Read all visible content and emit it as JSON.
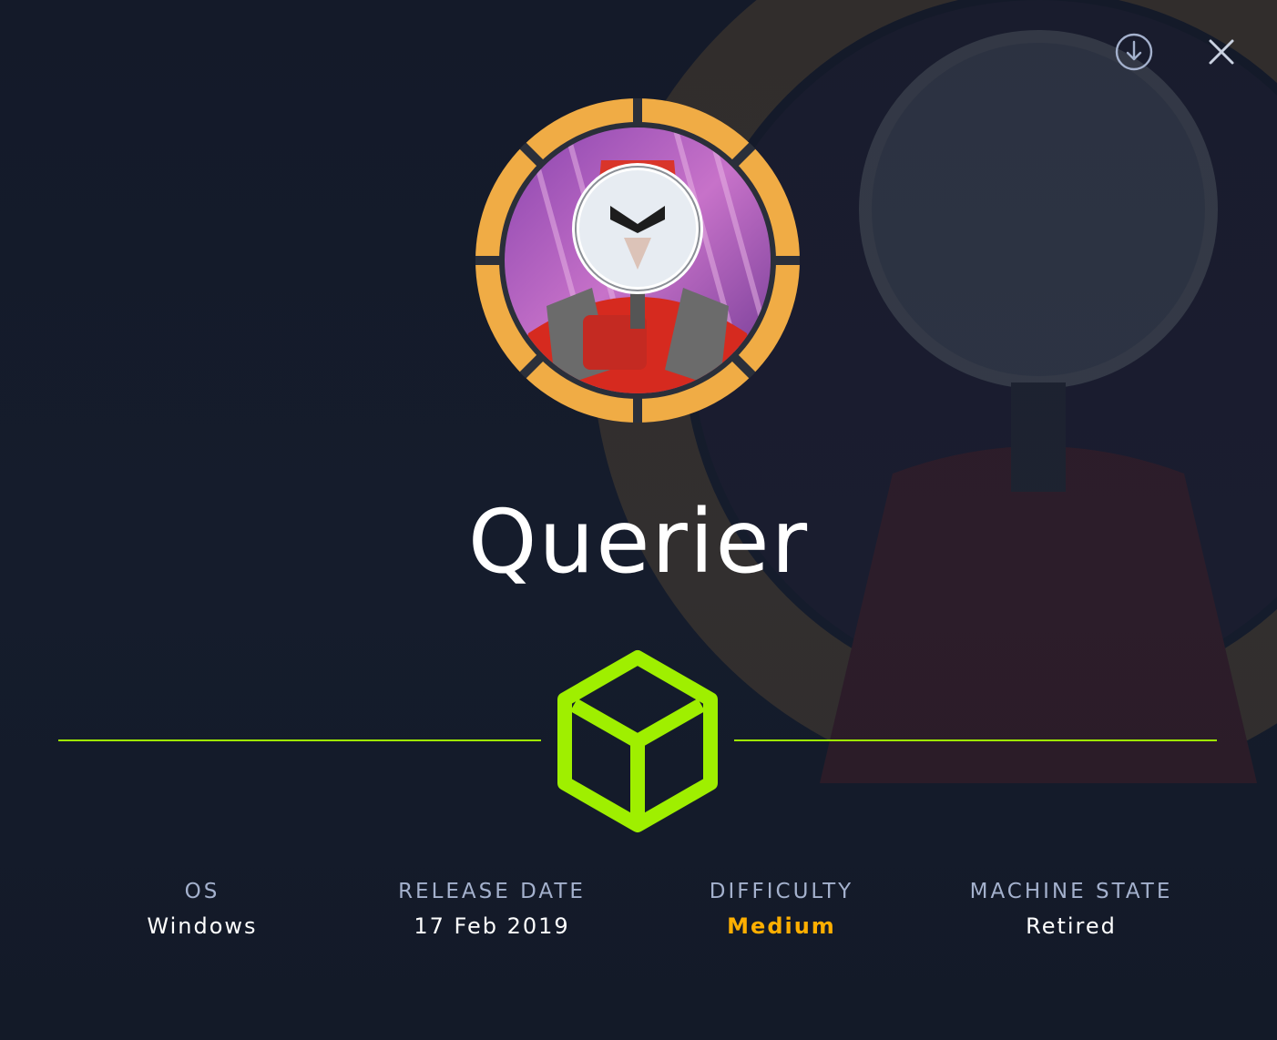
{
  "machine": {
    "name": "Querier"
  },
  "actions": {
    "download_icon": "download-circle-icon",
    "close_icon": "close-icon"
  },
  "stats": [
    {
      "label": "OS",
      "value": "Windows"
    },
    {
      "label": "RELEASE DATE",
      "value": "17 Feb 2019"
    },
    {
      "label": "DIFFICULTY",
      "value": "Medium"
    },
    {
      "label": "MACHINE STATE",
      "value": "Retired"
    }
  ],
  "colors": {
    "background": "#151b2b",
    "accent_green": "#9fef00",
    "difficulty_medium": "#ffaf00",
    "badge_ring": "#f0ac45",
    "label_gray": "#a4b1cd"
  }
}
